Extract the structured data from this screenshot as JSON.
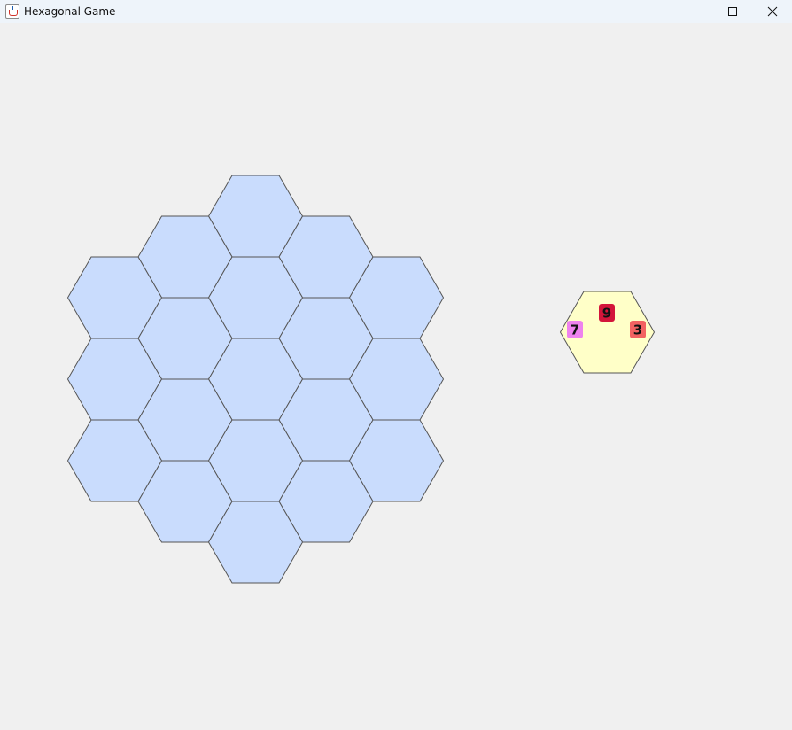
{
  "window": {
    "title": "Hexagonal Game",
    "icon": "java-coffee-cup-icon",
    "controls": [
      "minimize-icon",
      "maximize-icon",
      "close-icon"
    ]
  },
  "board": {
    "cell_fill": "#c9dcfd",
    "cell_stroke": "#555555",
    "cells": [
      {
        "q": 0,
        "r": -2
      },
      {
        "q": 1,
        "r": -2
      },
      {
        "q": 2,
        "r": -2
      },
      {
        "q": -1,
        "r": -1
      },
      {
        "q": 0,
        "r": -1
      },
      {
        "q": 1,
        "r": -1
      },
      {
        "q": 2,
        "r": -1
      },
      {
        "q": -2,
        "r": 0
      },
      {
        "q": -1,
        "r": 0
      },
      {
        "q": 0,
        "r": 0
      },
      {
        "q": 1,
        "r": 0
      },
      {
        "q": 2,
        "r": 0
      },
      {
        "q": -2,
        "r": 1
      },
      {
        "q": -1,
        "r": 1
      },
      {
        "q": 0,
        "r": 1
      },
      {
        "q": 1,
        "r": 1
      },
      {
        "q": -2,
        "r": 2
      },
      {
        "q": -1,
        "r": 2
      },
      {
        "q": 0,
        "r": 2
      }
    ]
  },
  "piece": {
    "fill": "#ffffc8",
    "stroke": "#555555",
    "tokens": [
      {
        "label": "9",
        "color": "#d3153a",
        "slot": "top"
      },
      {
        "label": "7",
        "color": "#ee82ee",
        "slot": "left"
      },
      {
        "label": "3",
        "color": "#f26262",
        "slot": "right"
      }
    ]
  }
}
